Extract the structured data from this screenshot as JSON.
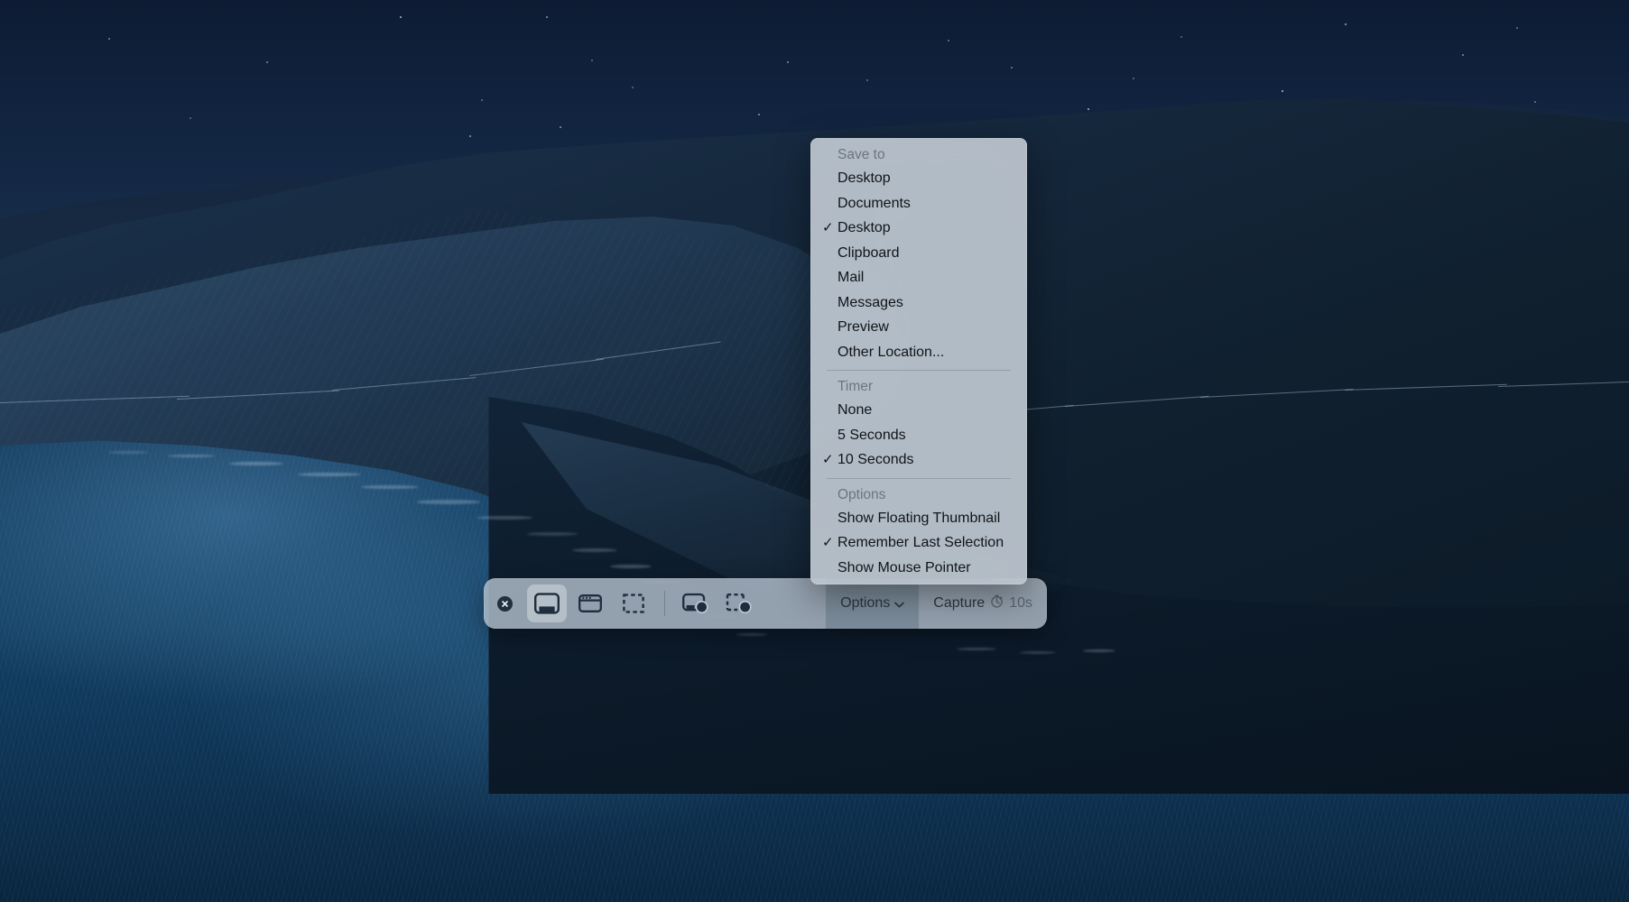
{
  "desktop": {
    "wallpaper_name": "big-sur-coast-night-wallpaper",
    "sky_color": "#0d1c33",
    "ocean_color": "#123f63",
    "mountain_color": "#16293f"
  },
  "toolbar": {
    "name": "screenshot-capture-toolbar",
    "close_label": "Close screenshot toolbar",
    "buttons": [
      {
        "id": "capture-entire-screen",
        "label": "Capture Entire Screen",
        "selected": true
      },
      {
        "id": "capture-selected-window",
        "label": "Capture Selected Window",
        "selected": false
      },
      {
        "id": "capture-selected-portion",
        "label": "Capture Selected Portion",
        "selected": false
      },
      {
        "id": "record-entire-screen",
        "label": "Record Entire Screen",
        "selected": false
      },
      {
        "id": "record-selected-portion",
        "label": "Record Selected Portion",
        "selected": false
      }
    ],
    "options_label": "Options",
    "capture_label": "Capture",
    "timer_value": "10s"
  },
  "options_menu": {
    "sections": [
      {
        "title": "Save to",
        "items": [
          {
            "label": "Desktop",
            "checked": false
          },
          {
            "label": "Documents",
            "checked": false
          },
          {
            "label": "Desktop",
            "checked": true
          },
          {
            "label": "Clipboard",
            "checked": false
          },
          {
            "label": "Mail",
            "checked": false
          },
          {
            "label": "Messages",
            "checked": false
          },
          {
            "label": "Preview",
            "checked": false
          },
          {
            "label": "Other Location...",
            "checked": false
          }
        ]
      },
      {
        "title": "Timer",
        "items": [
          {
            "label": "None",
            "checked": false
          },
          {
            "label": "5 Seconds",
            "checked": false
          },
          {
            "label": "10 Seconds",
            "checked": true
          }
        ]
      },
      {
        "title": "Options",
        "items": [
          {
            "label": "Show Floating Thumbnail",
            "checked": false
          },
          {
            "label": "Remember Last Selection",
            "checked": true
          },
          {
            "label": "Show Mouse Pointer",
            "checked": false
          }
        ]
      }
    ],
    "checkmark_glyph": "✓"
  }
}
